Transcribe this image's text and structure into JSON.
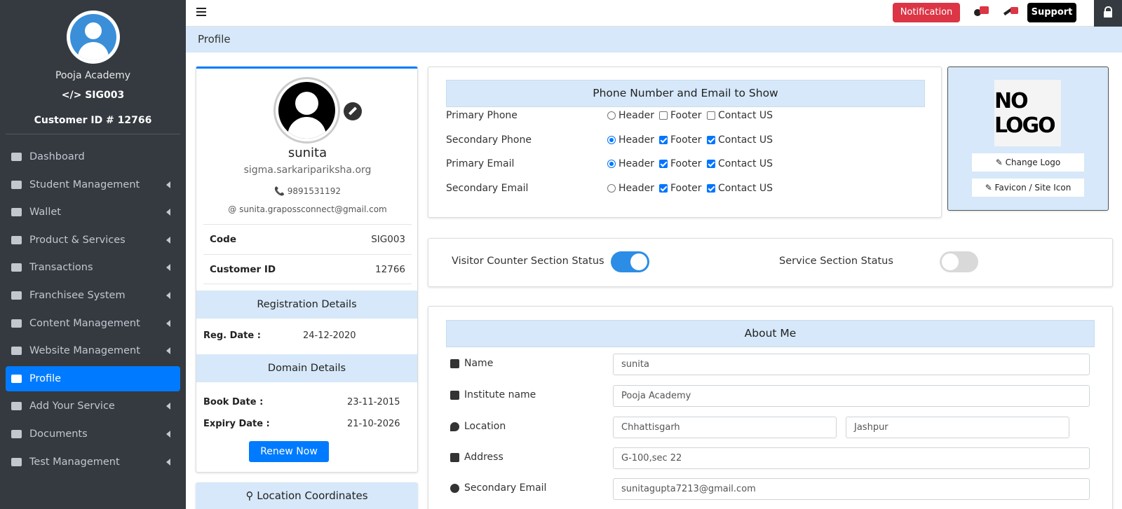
{
  "sidebar": {
    "academy": "Pooja Academy",
    "code": "</> SIG003",
    "customer": "Customer ID # 12766",
    "items": [
      {
        "label": "Dashboard",
        "icon": "dashboard-icon",
        "caret": false,
        "active": false
      },
      {
        "label": "Student Management",
        "icon": "user-icon",
        "caret": true,
        "active": false
      },
      {
        "label": "Wallet",
        "icon": "wallet-icon",
        "caret": true,
        "active": false
      },
      {
        "label": "Product & Services",
        "icon": "briefcase-icon",
        "caret": true,
        "active": false
      },
      {
        "label": "Transactions",
        "icon": "exchange-icon",
        "caret": true,
        "active": false
      },
      {
        "label": "Franchisee System",
        "icon": "handshake-icon",
        "caret": true,
        "active": false
      },
      {
        "label": "Content Management",
        "icon": "gear-icon",
        "caret": true,
        "active": false
      },
      {
        "label": "Website Management",
        "icon": "gear-icon",
        "caret": true,
        "active": false
      },
      {
        "label": "Profile",
        "icon": "id-card-icon",
        "caret": false,
        "active": true
      },
      {
        "label": "Add Your Service",
        "icon": "gears-icon",
        "caret": true,
        "active": false
      },
      {
        "label": "Documents",
        "icon": "book-icon",
        "caret": true,
        "active": false
      },
      {
        "label": "Test Management",
        "icon": "book-icon",
        "caret": true,
        "active": false
      }
    ]
  },
  "topbar": {
    "notification": "Notification",
    "support": "Support"
  },
  "page_title": "Profile",
  "profile": {
    "name": "sunita",
    "website": "sigma.sarkaripariksha.org",
    "phone": "📞 9891531192",
    "email": "@ sunita.grapossconnect@gmail.com",
    "code_label": "Code",
    "code_value": "SIG003",
    "cust_label": "Customer ID",
    "cust_value": "12766",
    "reg_title": "Registration Details",
    "reg_date_label": "Reg. Date :",
    "reg_date": "24-12-2020",
    "domain_title": "Domain Details",
    "book_label": "Book Date :",
    "book_date": "23-11-2015",
    "expiry_label": "Expiry Date :",
    "expiry_date": "21-10-2026",
    "renew": "Renew Now",
    "location_title": "Location Coordinates"
  },
  "contact": {
    "title": "Phone Number and Email to Show",
    "options": [
      "Header",
      "Footer",
      "Contact US"
    ],
    "rows": [
      {
        "label": "Primary Phone",
        "header": false,
        "footer": false,
        "contact": false
      },
      {
        "label": "Secondary Phone",
        "header": true,
        "footer": true,
        "contact": true
      },
      {
        "label": "Primary Email",
        "header": true,
        "footer": true,
        "contact": true
      },
      {
        "label": "Secondary Email",
        "header": false,
        "footer": true,
        "contact": true
      }
    ]
  },
  "logo": {
    "placeholder": "NO LOGO",
    "change_logo": "✎ Change Logo",
    "favicon": "✎ Favicon / Site Icon"
  },
  "status": {
    "visitor_label": "Visitor Counter Section Status",
    "visitor_on": true,
    "service_label": "Service Section Status",
    "service_on": false
  },
  "about": {
    "title": "About Me",
    "name_label": "Name",
    "name": "sunita",
    "institute_label": "Institute name",
    "institute": "Pooja Academy",
    "location_label": "Location",
    "state": "Chhattisgarh",
    "city": "Jashpur",
    "address_label": "Address",
    "address": "G-100,sec 22",
    "sec_email_label": "Secondary Email",
    "sec_email": "sunitagupta7213@gmail.com"
  }
}
